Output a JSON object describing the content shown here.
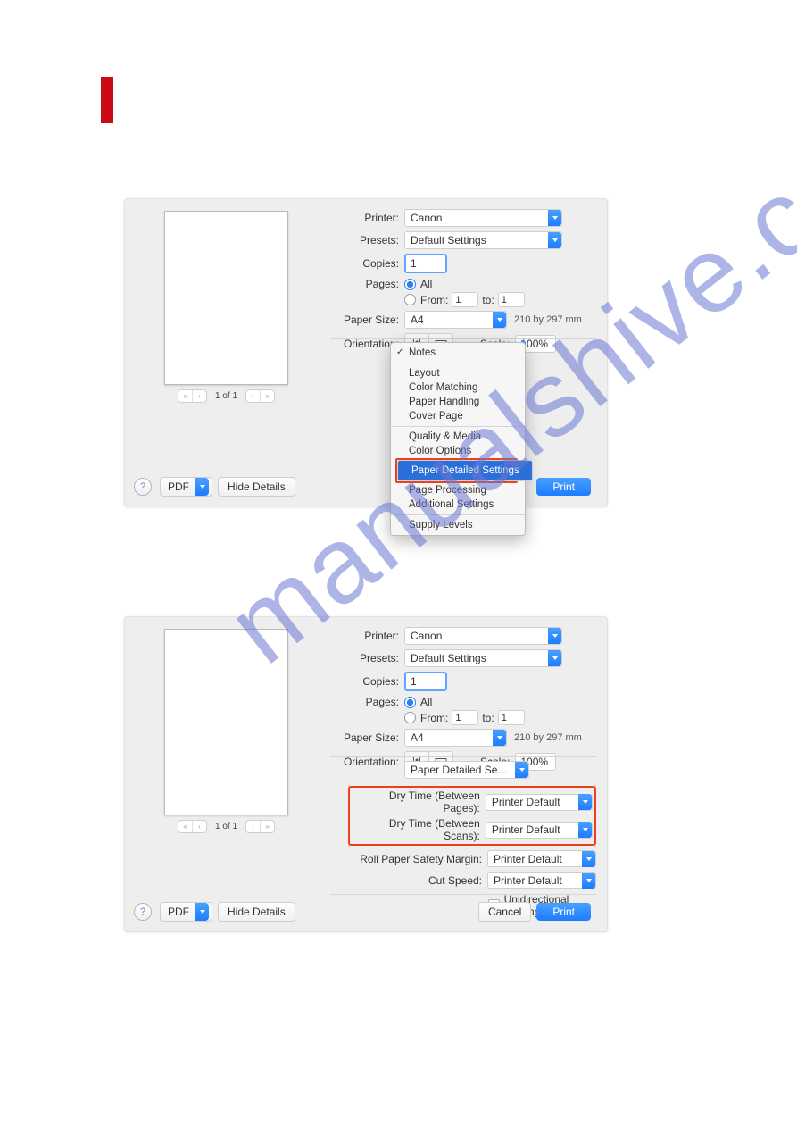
{
  "watermark": "manualshive.com",
  "labels": {
    "printer": "Printer:",
    "presets": "Presets:",
    "copies": "Copies:",
    "pages": "Pages:",
    "all": "All",
    "from": "From:",
    "to": "to:",
    "paper_size": "Paper Size:",
    "orientation": "Orientation:",
    "scale": "Scale:"
  },
  "values": {
    "printer": "Canon",
    "presets": "Default Settings",
    "copies": "1",
    "from": "1",
    "to": "1",
    "paper_size": "A4",
    "paper_dim": "210 by 297 mm",
    "scale": "100%"
  },
  "preview": {
    "counter": "1 of 1"
  },
  "popup_menu": {
    "group1": [
      "Notes"
    ],
    "group2": [
      "Layout",
      "Color Matching",
      "Paper Handling",
      "Cover Page"
    ],
    "group3": [
      "Quality & Media",
      "Color Options",
      "Paper Detailed Settings",
      "Page Processing",
      "Additional Settings"
    ],
    "group4": [
      "Supply Levels"
    ],
    "selected": "Paper Detailed Settings"
  },
  "bottom": {
    "pdf": "PDF",
    "hide_details": "Hide Details",
    "cancel": "Cancel",
    "print": "Print"
  },
  "dialog2": {
    "section_dropdown": "Paper Detailed Settings",
    "rows": {
      "dry_pages_label": "Dry Time (Between Pages):",
      "dry_pages_value": "Printer Default",
      "dry_scans_label": "Dry Time (Between Scans):",
      "dry_scans_value": "Printer Default",
      "safety_label": "Roll Paper Safety Margin:",
      "safety_value": "Printer Default",
      "cut_label": "Cut Speed:",
      "cut_value": "Printer Default"
    },
    "checkbox": "Unidirectional Printing"
  }
}
